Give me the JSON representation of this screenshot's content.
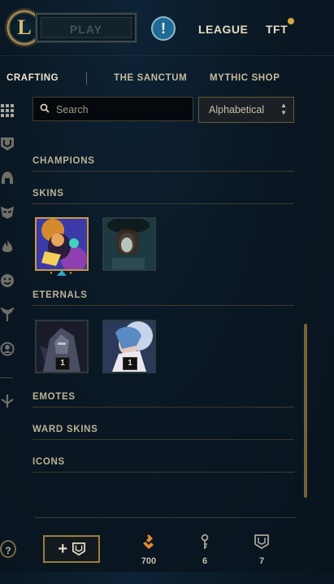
{
  "topbar": {
    "logo_letter": "L",
    "play_label": "PLAY",
    "alert_label": "!",
    "nav": [
      "LEAGUE",
      "TFT"
    ]
  },
  "subnav": {
    "tabs": [
      "CRAFTING",
      "THE SANCTUM",
      "MYTHIC SHOP"
    ],
    "active": "CRAFTING"
  },
  "rail": {
    "icons": [
      "grid-icon",
      "chest-icon",
      "helmet-icon",
      "mask-icon",
      "flame-icon",
      "emote-face-icon",
      "ward-icon",
      "profile-icon",
      "sigil-icon"
    ]
  },
  "search": {
    "placeholder": "Search",
    "value": ""
  },
  "sort": {
    "selected": "Alphabetical"
  },
  "sections": {
    "champions": "CHAMPIONS",
    "skins": "SKINS",
    "eternals": "ETERNALS",
    "emotes": "EMOTES",
    "ward_skins": "WARD SKINS",
    "icons": "ICONS"
  },
  "eternals": [
    {
      "count": "1"
    },
    {
      "count": "1"
    }
  ],
  "footer": {
    "help_label": "?",
    "add_chest_label": "+",
    "currencies": [
      {
        "icon": "orange-essence-icon",
        "value": "700"
      },
      {
        "icon": "key-fragment-icon",
        "value": "6"
      },
      {
        "icon": "chest-icon",
        "value": "7"
      }
    ]
  },
  "colors": {
    "gold": "#c99a43",
    "orange_essence": "#e58a34",
    "accent_blue": "#2fa4c9"
  }
}
